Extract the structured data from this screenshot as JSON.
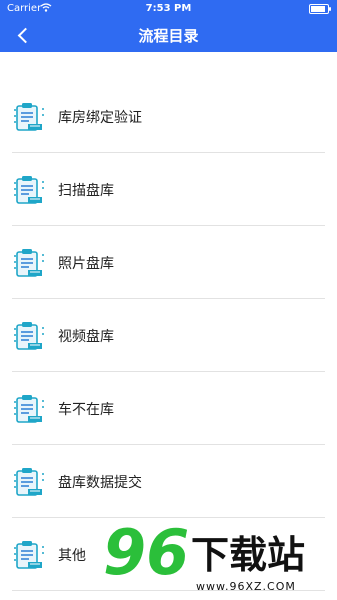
{
  "status_bar": {
    "carrier": "Carrier",
    "time": "7:53 PM"
  },
  "header": {
    "title": "流程目录"
  },
  "menu": [
    {
      "label": "库房绑定验证",
      "icon": "clipboard-icon"
    },
    {
      "label": "扫描盘库",
      "icon": "clipboard-icon"
    },
    {
      "label": "照片盘库",
      "icon": "clipboard-icon"
    },
    {
      "label": "视频盘库",
      "icon": "clipboard-icon"
    },
    {
      "label": "车不在库",
      "icon": "clipboard-icon"
    },
    {
      "label": "盘库数据提交",
      "icon": "clipboard-icon"
    },
    {
      "label": "其他",
      "icon": "clipboard-icon"
    }
  ],
  "watermark": {
    "brand": "96下载站",
    "url": "www.96XZ.COM"
  },
  "colors": {
    "header": "#2f6bf2",
    "icon_teal": "#1fa6c8",
    "icon_blue": "#2a7fd4",
    "watermark_green": "#2bbf3a"
  }
}
